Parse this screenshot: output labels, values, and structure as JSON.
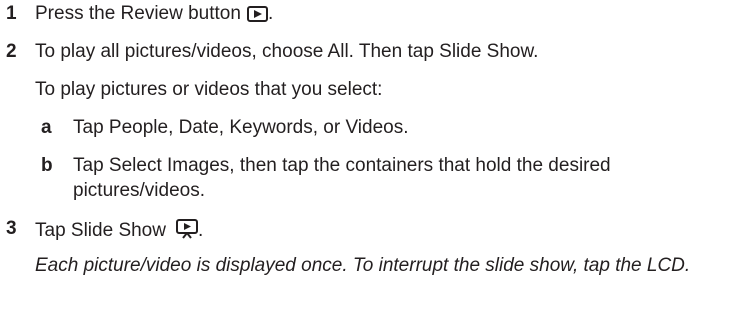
{
  "steps": [
    {
      "number": "1",
      "text": "Press the Review button",
      "trailing": ".",
      "icon": "review-play-icon"
    },
    {
      "number": "2",
      "text": "To play all pictures/videos, choose All. Then tap Slide Show.",
      "sub_intro": "To play pictures or videos that you select:",
      "substeps": [
        {
          "letter": "a",
          "text": "Tap People, Date, Keywords, or Videos."
        },
        {
          "letter": "b",
          "text_line1": "Tap Select Images, then tap the containers that hold the desired",
          "text_line2": "pictures/videos."
        }
      ]
    },
    {
      "number": "3",
      "text": "Tap Slide Show",
      "trailing": ".",
      "icon": "slide-show-icon",
      "note": "Each picture/video is displayed once. To interrupt the slide show, tap the LCD."
    }
  ]
}
